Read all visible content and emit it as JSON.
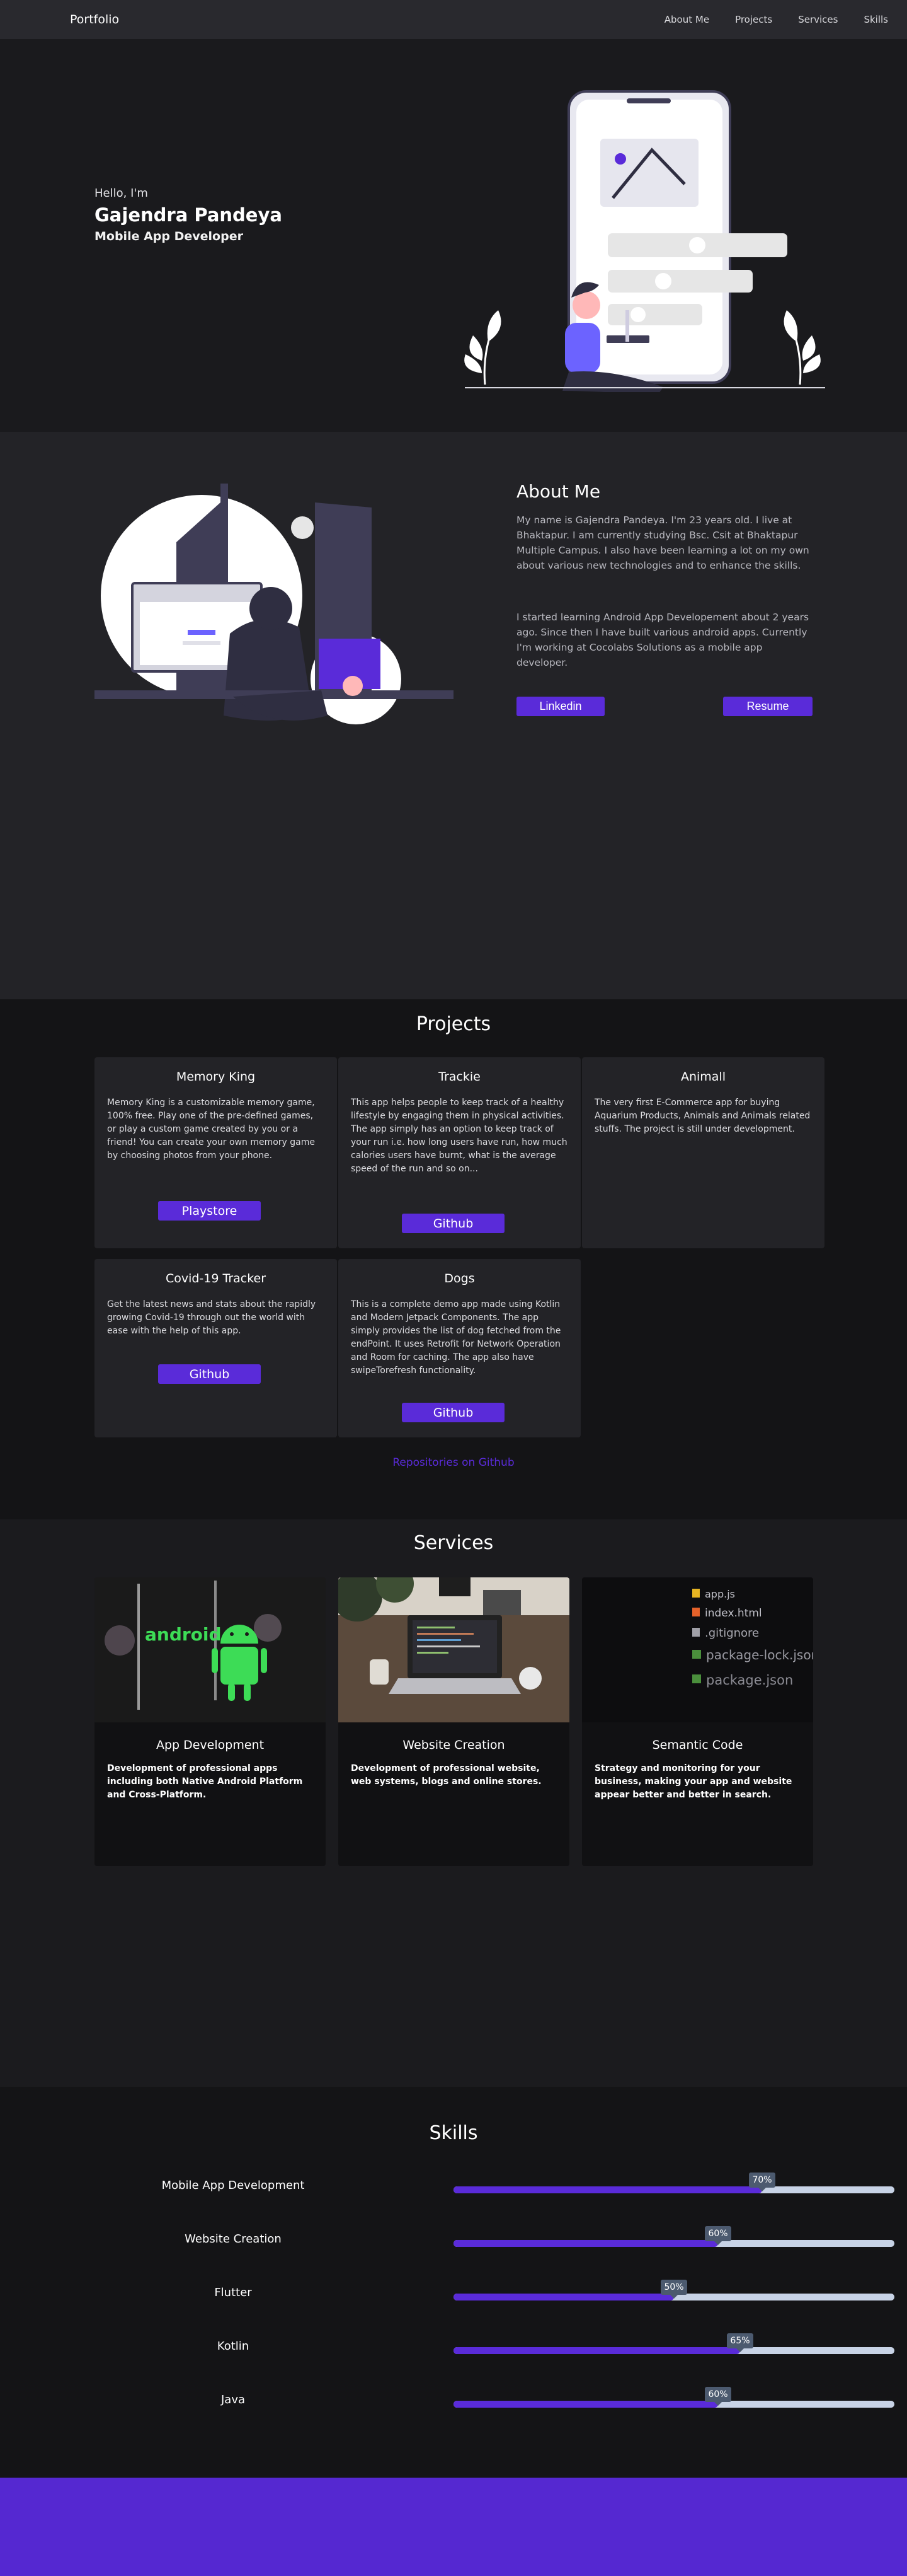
{
  "nav": {
    "brand": "Portfolio",
    "links": [
      "About Me",
      "Projects",
      "Services",
      "Skills"
    ]
  },
  "hero": {
    "greeting": "Hello, I'm",
    "name": "Gajendra Pandeya",
    "role": "Mobile App Developer"
  },
  "about": {
    "title": "About Me",
    "paragraph1": "My name is Gajendra Pandeya. I'm 23 years old. I live at Bhaktapur. I am currently studying Bsc. Csit at Bhaktapur Multiple Campus. I also have been learning a lot on my own about various new technologies and to enhance the skills.",
    "paragraph2": "I started learning Android App Developement about 2 years ago. Since then I have built various android apps. Currently I'm working at Cocolabs Solutions as a mobile app developer.",
    "linkedin_label": "Linkedin",
    "resume_label": "Resume"
  },
  "projects": {
    "title": "Projects",
    "items": [
      {
        "name": "Memory King",
        "description": "Memory King is a customizable memory game, 100% free. Play one of the pre-defined games, or play a custom game created by you or a friend! You can create your own memory game by choosing photos from your phone.",
        "button": "Playstore"
      },
      {
        "name": "Trackie",
        "description": "This app helps people to keep track of a healthy lifestyle by engaging them in physical activities. The app simply has an option to keep track of your run i.e. how long users have run, how much calories users have burnt, what is the average speed of the run and so on...",
        "button": "Github"
      },
      {
        "name": "Animall",
        "description": "The very first E-Commerce app for buying Aquarium Products, Animals and Animals related stuffs. The project is still under development.",
        "button": ""
      },
      {
        "name": "Covid-19 Tracker",
        "description": "Get the latest news and stats about the rapidly growing Covid-19 through out the world with ease with the help of this app.",
        "button": "Github"
      },
      {
        "name": "Dogs",
        "description": "This is a complete demo app made using Kotlin and Modern Jetpack Components. The app simply provides the list of dog fetched from the endPoint. It uses Retrofit for Network Operation and Room for caching. The app also have swipeTorefresh functionality.",
        "button": "Github"
      }
    ],
    "more_link": "Repositories on Github"
  },
  "services": {
    "title": "Services",
    "items": [
      {
        "name": "App Development",
        "description": "Development of professional apps including both Native Android Platform and Cross-Platform.",
        "image_text": "android"
      },
      {
        "name": "Website Creation",
        "description": "Development of professional website, web systems, blogs and online stores."
      },
      {
        "name": "Semantic Code",
        "description": "Strategy and monitoring for your business, making your app and website appear better and better in search.",
        "code_lines": [
          "app.js",
          "index.html",
          ".gitignore",
          "package-lock.json",
          "package.json"
        ]
      }
    ]
  },
  "skills": {
    "title": "Skills",
    "items": [
      {
        "name": "Mobile App Development",
        "percent": 70,
        "label": "70%"
      },
      {
        "name": "Website Creation",
        "percent": 60,
        "label": "60%"
      },
      {
        "name": "Flutter",
        "percent": 50,
        "label": "50%"
      },
      {
        "name": "Kotlin",
        "percent": 65,
        "label": "65%"
      },
      {
        "name": "Java",
        "percent": 60,
        "label": "60%"
      }
    ]
  },
  "colors": {
    "accent": "#5a2bd9",
    "footer": "#5528d1",
    "track": "#c8d3e6",
    "tooltip": "#4c5a6f"
  }
}
